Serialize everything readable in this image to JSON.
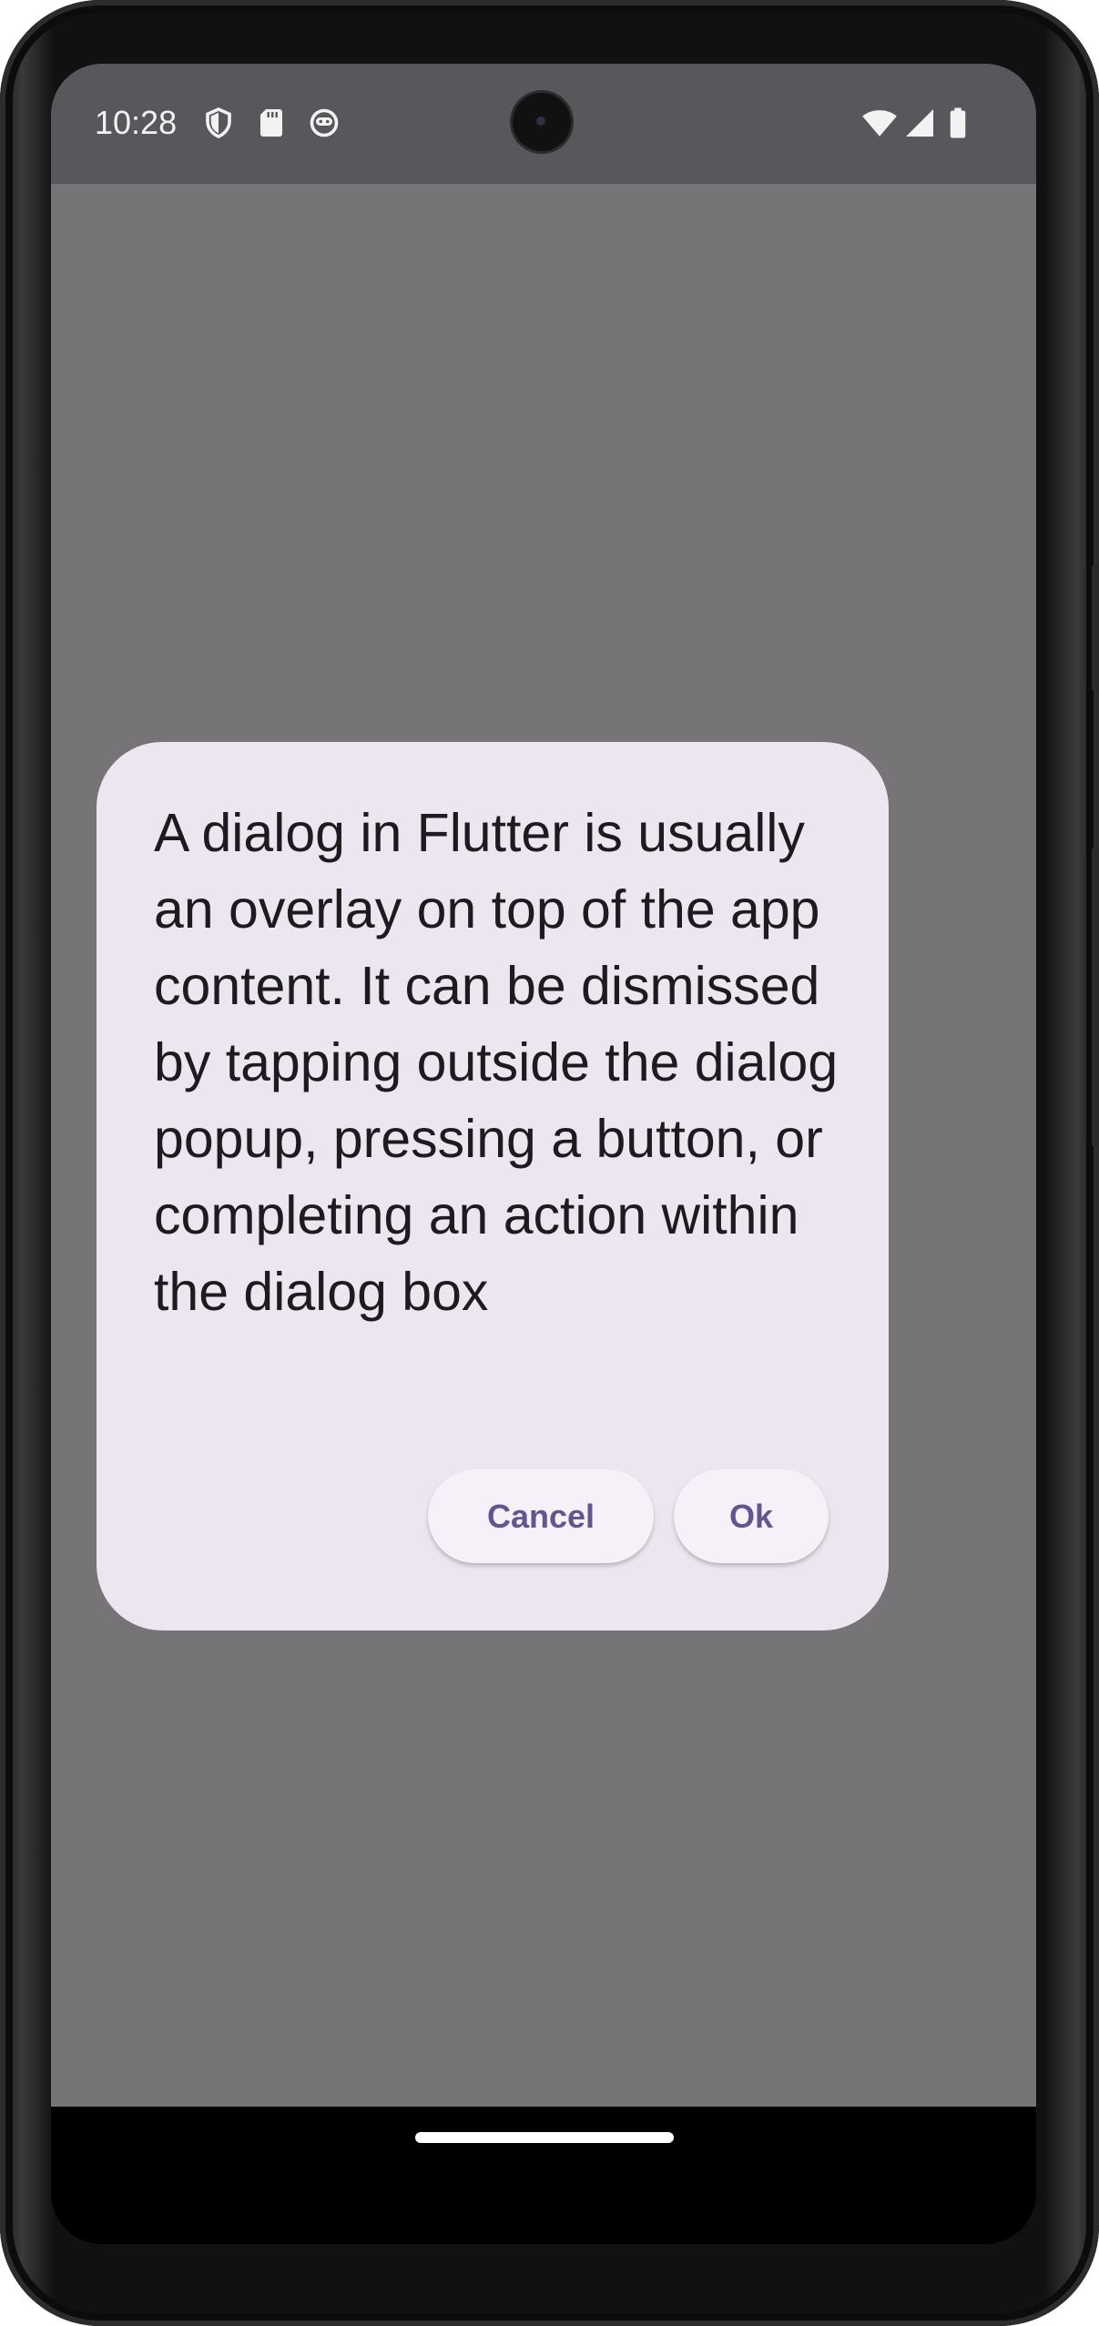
{
  "status_bar": {
    "time": "10:28",
    "left_icons": [
      "shield-icon",
      "sd-card-icon",
      "face-icon"
    ],
    "right_icons": [
      "wifi-icon",
      "signal-icon",
      "battery-icon"
    ]
  },
  "dialog": {
    "message": "A dialog in Flutter is usually an overlay on top of the app content. It can be dismissed by tapping outside the dialog popup, pressing a button, or completing an action within the dialog box",
    "cancel_label": "Cancel",
    "ok_label": "Ok"
  },
  "colors": {
    "scrim": "#767477",
    "dialog_surface": "#ece6f0",
    "button_text": "#65558f",
    "status_bar": "#59575b"
  }
}
